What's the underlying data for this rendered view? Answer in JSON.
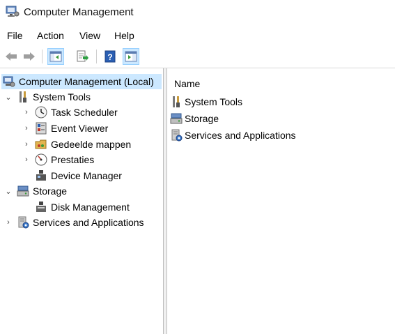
{
  "window": {
    "title": "Computer Management"
  },
  "menu": {
    "items": [
      "File",
      "Action",
      "View",
      "Help"
    ]
  },
  "toolbar": {
    "buttons": [
      "back-icon",
      "forward-icon",
      "show-hide-console-tree-icon",
      "export-list-icon",
      "help-icon",
      "show-hide-action-pane-icon"
    ]
  },
  "tree": {
    "root": "Computer Management (Local)",
    "system_tools": "System Tools",
    "task_scheduler": "Task Scheduler",
    "event_viewer": "Event Viewer",
    "shared_folders": "Gedeelde mappen",
    "performance": "Prestaties",
    "device_manager": "Device Manager",
    "storage": "Storage",
    "disk_management": "Disk Management",
    "services": "Services and Applications"
  },
  "list": {
    "column": "Name",
    "items": [
      "System Tools",
      "Storage",
      "Services and Applications"
    ]
  },
  "colors": {
    "selection": "#cce8ff",
    "selection_border": "#99d1ff"
  }
}
